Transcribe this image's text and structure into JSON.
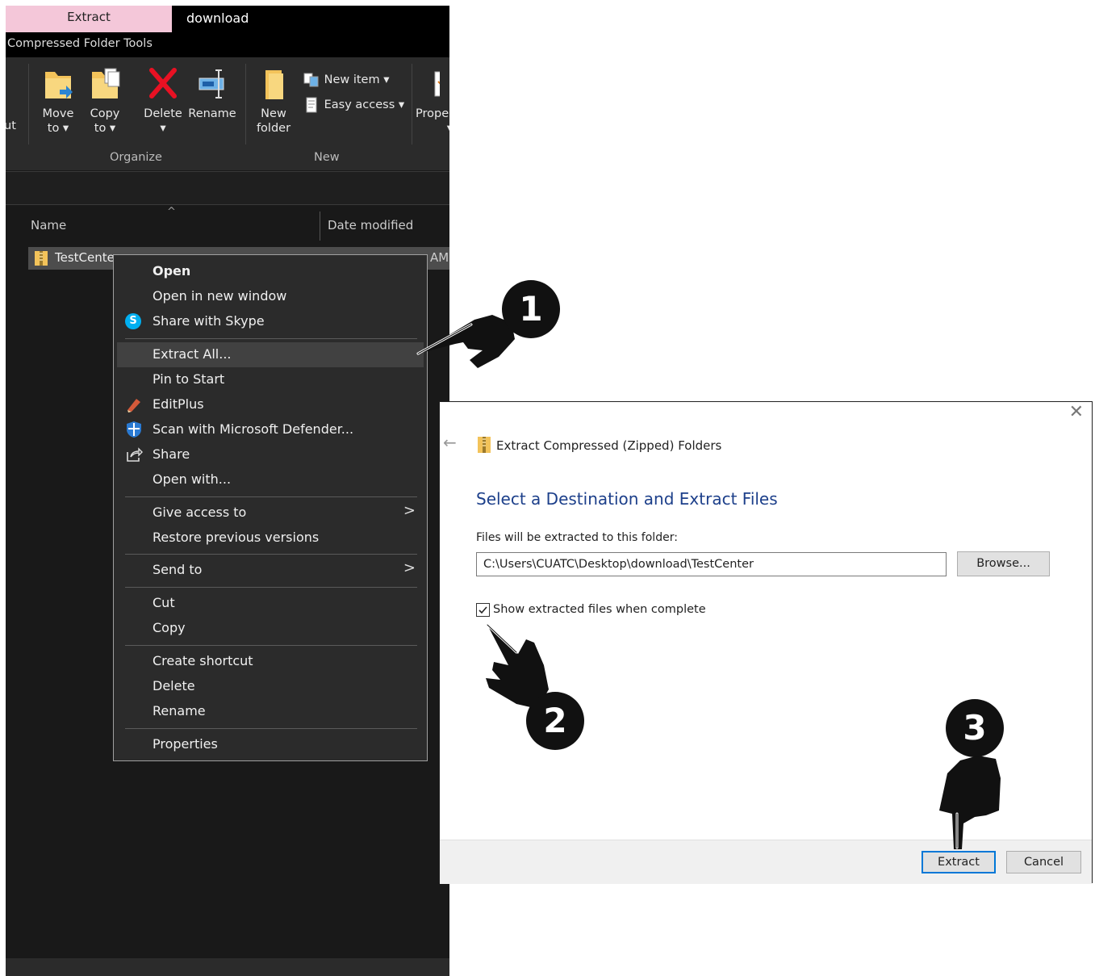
{
  "explorer": {
    "tabs": {
      "extract": "Extract",
      "download": "download"
    },
    "context_tab": "Compressed Folder Tools",
    "ribbon": {
      "cut_partial": "ut",
      "move_to": [
        "Move",
        "to ▾"
      ],
      "copy_to": [
        "Copy",
        "to ▾"
      ],
      "delete": "Delete",
      "delete_arrow": "▾",
      "rename": "Rename",
      "new_folder": [
        "New",
        "folder"
      ],
      "new_item": "New item ▾",
      "easy_access": "Easy access ▾",
      "properties_partial": "Prope",
      "properties_arrow": "▾",
      "group_organize": "Organize",
      "group_new": "New"
    },
    "columns": {
      "name": "Name",
      "date_modified": "Date modified",
      "sort_glyph": "^"
    },
    "file": {
      "name": "TestCente",
      "date_partial": "AM"
    }
  },
  "context_menu": {
    "items": [
      {
        "label": "Open"
      },
      {
        "label": "Open in new window"
      },
      {
        "label": "Share with Skype",
        "icon": "skype-icon"
      },
      {
        "label": "Extract All..."
      },
      {
        "label": "Pin to Start"
      },
      {
        "label": "EditPlus",
        "icon": "editplus-icon"
      },
      {
        "label": "Scan with Microsoft Defender...",
        "icon": "defender-shield-icon"
      },
      {
        "label": "Share",
        "icon": "share-icon"
      },
      {
        "label": "Open with..."
      },
      {
        "label": "Give access to"
      },
      {
        "label": "Restore previous versions"
      },
      {
        "label": "Send to"
      },
      {
        "label": "Cut"
      },
      {
        "label": "Copy"
      },
      {
        "label": "Create shortcut"
      },
      {
        "label": "Delete"
      },
      {
        "label": "Rename"
      },
      {
        "label": "Properties"
      }
    ],
    "submenu_glyph": ">",
    "skype_glyph": "S"
  },
  "dialog": {
    "close_glyph": "✕",
    "back_glyph": "←",
    "title": "Extract Compressed (Zipped) Folders",
    "heading": "Select a Destination and Extract Files",
    "label": "Files will be extracted to this folder:",
    "path": "C:\\Users\\CUATC\\Desktop\\download\\TestCenter",
    "browse": "Browse...",
    "checkbox_label": "Show extracted files when complete",
    "checkbox_checked": true,
    "extract": "Extract",
    "cancel": "Cancel"
  },
  "annotations": {
    "step1": "1",
    "step2": "2",
    "step3": "3"
  },
  "colors": {
    "accent": "#0078d7",
    "heading": "#1c3f8a",
    "tab_extract": "#f4c7d9",
    "delete_red": "#e81123"
  }
}
